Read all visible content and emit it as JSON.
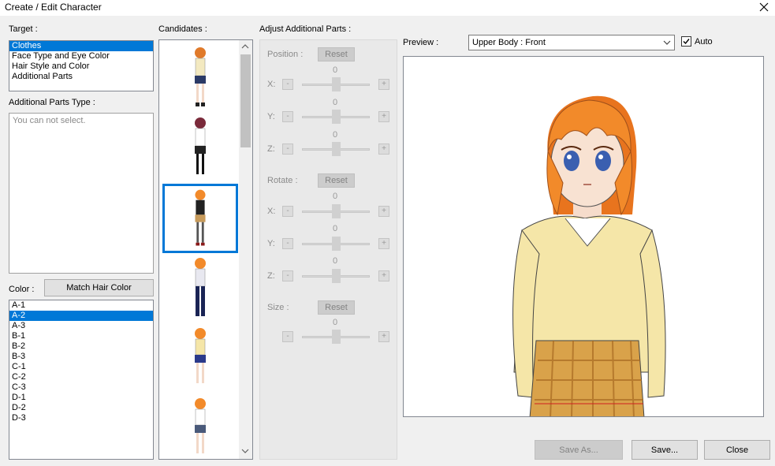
{
  "window": {
    "title": "Create / Edit Character"
  },
  "target": {
    "label": "Target :",
    "items": [
      "Clothes",
      "Face Type and Eye Color",
      "Hair Style and Color",
      "Additional Parts"
    ],
    "selected_index": 0
  },
  "additional_parts_type": {
    "label": "Additional Parts Type :",
    "placeholder": "You can not select."
  },
  "color": {
    "label": "Color :",
    "match_button": "Match Hair Color",
    "items": [
      "A-1",
      "A-2",
      "A-3",
      "B-1",
      "B-2",
      "B-3",
      "C-1",
      "C-2",
      "C-3",
      "D-1",
      "D-2",
      "D-3"
    ],
    "selected_index": 1
  },
  "candidates": {
    "label": "Candidates :",
    "selected_index": 2
  },
  "adjust": {
    "label": "Adjust Additional Parts :",
    "position_label": "Position :",
    "rotate_label": "Rotate :",
    "size_label": "Size :",
    "reset_label": "Reset",
    "x_label": "X:",
    "y_label": "Y:",
    "z_label": "Z:",
    "minus": "-",
    "plus": "+",
    "value_zero": "0"
  },
  "preview": {
    "label": "Preview :",
    "view_selected": "Upper Body : Front",
    "auto_label": "Auto",
    "auto_checked": true
  },
  "footer": {
    "save_as": "Save As...",
    "save": "Save...",
    "close": "Close"
  },
  "colors": {
    "selection": "#0078d7",
    "hair": "#f28a2a",
    "sweater": "#f5e6a8",
    "skirt": "#d9a24a"
  },
  "icons": {
    "close": "close-icon",
    "dropdown": "chevron-down-icon",
    "check": "checkmark-icon"
  }
}
